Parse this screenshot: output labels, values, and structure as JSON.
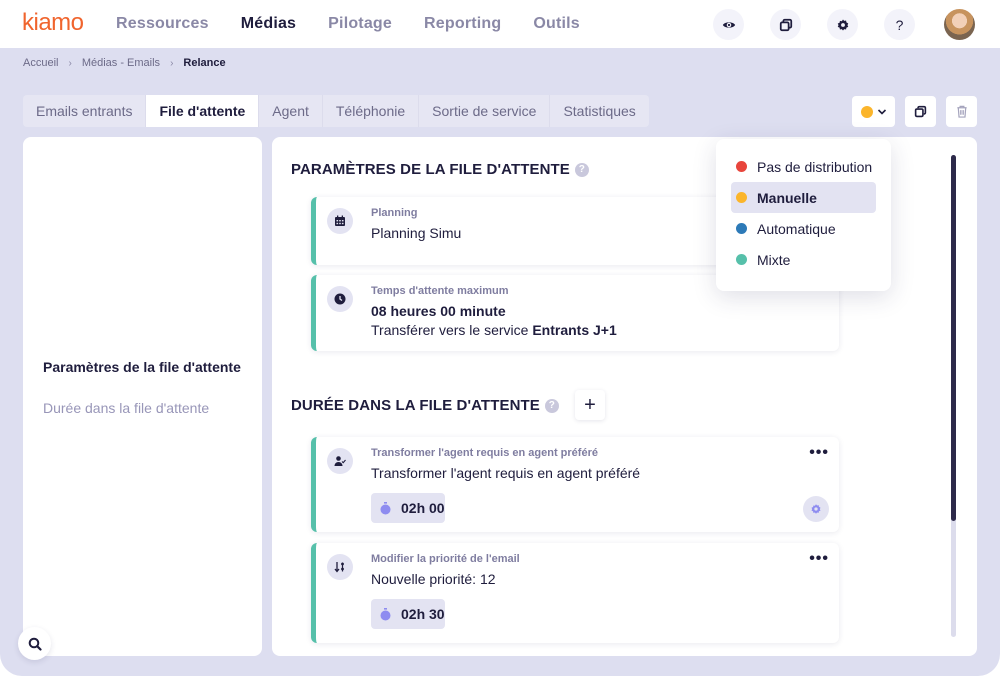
{
  "app": {
    "logo": "kiamo",
    "brand_color": "#f0642d"
  },
  "nav": {
    "items": [
      {
        "label": "Ressources",
        "active": false
      },
      {
        "label": "Médias",
        "active": true
      },
      {
        "label": "Pilotage",
        "active": false
      },
      {
        "label": "Reporting",
        "active": false
      },
      {
        "label": "Outils",
        "active": false
      }
    ],
    "icons": [
      "eye-icon",
      "windows-icon",
      "gear-icon",
      "help-icon"
    ],
    "help_label": "?"
  },
  "breadcrumb": {
    "items": [
      "Accueil",
      "Médias - Emails",
      "Relance"
    ],
    "separator": "›"
  },
  "tabs": [
    {
      "label": "Emails entrants",
      "active": false
    },
    {
      "label": "File d'attente",
      "active": true
    },
    {
      "label": "Agent",
      "active": false
    },
    {
      "label": "Téléphonie",
      "active": false
    },
    {
      "label": "Sortie de service",
      "active": false
    },
    {
      "label": "Statistiques",
      "active": false
    }
  ],
  "toolbar": {
    "status_color": "#fbb52b",
    "status_value": "Manuelle"
  },
  "left_panel": {
    "items": [
      {
        "label": "Paramètres de la file d'attente",
        "active": true
      },
      {
        "label": "Durée dans la file d'attente",
        "active": false
      }
    ]
  },
  "main": {
    "section1": {
      "title": "PARAMÈTRES DE LA FILE D'ATTENTE",
      "help": "?",
      "cards": [
        {
          "label": "Planning",
          "value": "Planning Simu",
          "icon": "calendar-icon"
        },
        {
          "label": "Temps d'attente maximum",
          "value": "08 heures 00 minute",
          "sub_prefix": "Transférer vers le service ",
          "sub_bold": "Entrants J+1",
          "icon": "clock-icon"
        }
      ]
    },
    "section2": {
      "title": "DURÉE DANS LA FILE D'ATTENTE",
      "help": "?",
      "add_label": "+",
      "cards": [
        {
          "label": "Transformer l'agent requis en agent préféré",
          "value": "Transformer l'agent requis en agent préféré",
          "timer": "02h 00",
          "icon": "user-check-icon",
          "more": "•••"
        },
        {
          "label": "Modifier la priorité de l'email",
          "value": "Nouvelle priorité: 12",
          "timer": "02h 30",
          "icon": "sort-icon",
          "more": "•••"
        }
      ]
    }
  },
  "dropdown": {
    "options": [
      {
        "label": "Pas de distribution",
        "color": "#e8453c",
        "selected": false
      },
      {
        "label": "Manuelle",
        "color": "#fbb52b",
        "selected": true
      },
      {
        "label": "Automatique",
        "color": "#2d7ab8",
        "selected": false
      },
      {
        "label": "Mixte",
        "color": "#56c0aa",
        "selected": false
      }
    ]
  },
  "scroll": {
    "thumb_fraction": 0.76
  }
}
